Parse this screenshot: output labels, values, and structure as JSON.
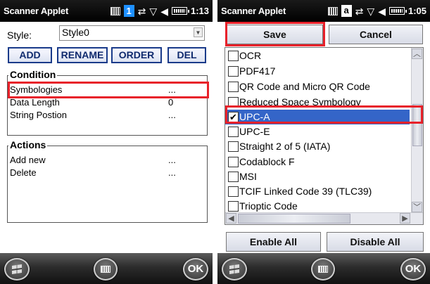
{
  "left": {
    "status_bar": {
      "title": "Scanner Applet",
      "input_mode": "1",
      "time": "1:13"
    },
    "style_label": "Style:",
    "style_value": "Style0",
    "buttons": {
      "add": "ADD",
      "rename": "RENAME",
      "order": "ORDER",
      "del": "DEL"
    },
    "condition": {
      "title": "Condition",
      "rows": [
        {
          "label": "Symbologies",
          "value": "..."
        },
        {
          "label": "Data Length",
          "value": "0"
        },
        {
          "label": "String Postion",
          "value": "..."
        }
      ]
    },
    "actions": {
      "title": "Actions",
      "rows": [
        {
          "label": "Add new",
          "value": "..."
        },
        {
          "label": "Delete",
          "value": "..."
        }
      ]
    },
    "taskbar": {
      "ok": "OK"
    }
  },
  "right": {
    "status_bar": {
      "title": "Scanner Applet",
      "input_mode": "a",
      "time": "1:05"
    },
    "save": "Save",
    "cancel": "Cancel",
    "symbologies": [
      {
        "label": "OCR",
        "checked": false
      },
      {
        "label": "PDF417",
        "checked": false
      },
      {
        "label": "QR Code and Micro QR Code",
        "checked": false
      },
      {
        "label": "Reduced Space Symbology",
        "checked": false
      },
      {
        "label": "UPC-A",
        "checked": true,
        "selected": true
      },
      {
        "label": "UPC-E",
        "checked": false
      },
      {
        "label": "Straight 2 of 5 (IATA)",
        "checked": false
      },
      {
        "label": "Codablock F",
        "checked": false
      },
      {
        "label": "MSI",
        "checked": false
      },
      {
        "label": "TCIF Linked Code 39 (TLC39)",
        "checked": false
      },
      {
        "label": "Trioptic Code",
        "checked": false
      }
    ],
    "enable_all": "Enable All",
    "disable_all": "Disable All",
    "taskbar": {
      "ok": "OK"
    }
  },
  "colors": {
    "highlight": "#e8212a",
    "selection": "#3465c8",
    "button_text": "#0f2a6e"
  }
}
